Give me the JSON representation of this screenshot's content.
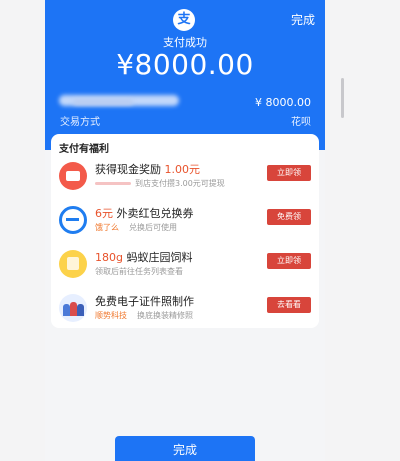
{
  "header": {
    "logo_glyph": "支",
    "done_label": "完成",
    "status": "支付成功",
    "amount": "¥8000.00"
  },
  "summary": {
    "amount_small": "¥ 8000.00",
    "left_label": "交易方式",
    "right_label": "花呗"
  },
  "benefits": {
    "title": "支付有福利",
    "items": [
      {
        "title_prefix": "获得现金奖励 ",
        "title_highlight": "1.00元",
        "title_suffix": "",
        "subtitle_tag": "",
        "subtitle": "到店支付攒3.00元可提现",
        "button": "立即领",
        "icon": "red-envelope-icon"
      },
      {
        "title_prefix": "",
        "title_highlight": "6元",
        "title_suffix": " 外卖红包兑换券",
        "subtitle_tag": "饿了么",
        "subtitle": "兑换后可使用",
        "button": "免费领",
        "icon": "eleme-icon"
      },
      {
        "title_prefix": "",
        "title_highlight": "180g",
        "title_suffix": " 蚂蚁庄园饲料",
        "subtitle_tag": "",
        "subtitle": "领取后前往任务列表查看",
        "button": "立即领",
        "icon": "feed-bag-icon"
      },
      {
        "title_prefix": "免费电子证件照制作",
        "title_highlight": "",
        "title_suffix": "",
        "subtitle_tag": "顺势科技",
        "subtitle": "换底换装精修照",
        "button": "去看看",
        "icon": "id-photo-icon"
      }
    ]
  },
  "footer": {
    "button": "完成"
  },
  "colors": {
    "brand_blue": "#1d74f5",
    "button_red": "#d8453b",
    "highlight_orange": "#e8532c"
  }
}
